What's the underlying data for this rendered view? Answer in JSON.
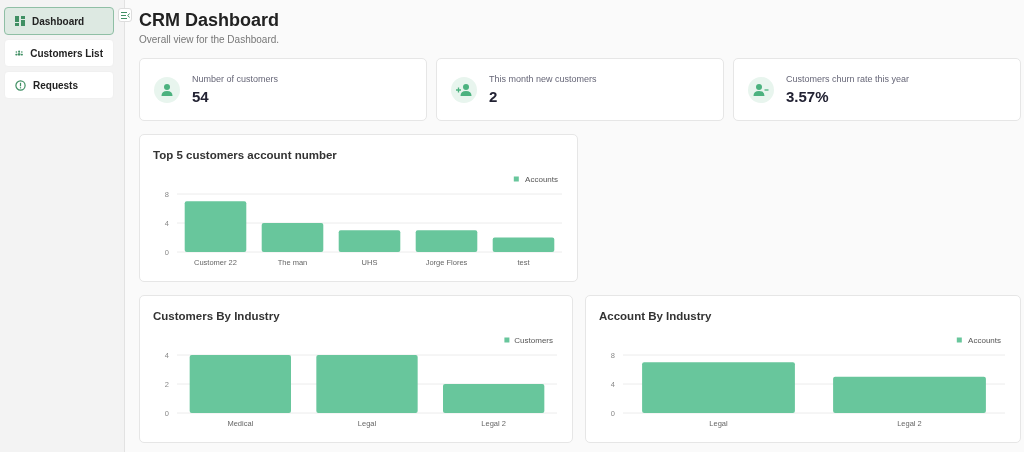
{
  "sidebar": {
    "items": [
      {
        "label": "Dashboard",
        "kind": "grid",
        "selected": true
      },
      {
        "label": "Customers List",
        "kind": "people",
        "selected": false
      },
      {
        "label": "Requests",
        "kind": "alert",
        "selected": false
      }
    ]
  },
  "header": {
    "title": "CRM Dashboard",
    "subtitle": "Overall view for the Dashboard."
  },
  "stats": [
    {
      "label": "Number of customers",
      "value": "54",
      "kind": "user"
    },
    {
      "label": "This month new customers",
      "value": "2",
      "kind": "user-plus"
    },
    {
      "label": "Customers churn rate this year",
      "value": "3.57%",
      "kind": "user-minus"
    }
  ],
  "charts": [
    {
      "title": "Top 5 customers account number",
      "chart_data": {
        "type": "bar",
        "categories": [
          "Customer 22",
          "The man",
          "UHS",
          "Jorge Flores",
          "test"
        ],
        "series": [
          {
            "name": "Accounts",
            "color": "#68c69c",
            "values": [
              7,
              4,
              3,
              3,
              2
            ]
          }
        ],
        "ylim": [
          0,
          8
        ],
        "yticks": [
          0,
          4,
          8
        ]
      }
    },
    {
      "title": "Customers By Industry",
      "chart_data": {
        "type": "bar",
        "categories": [
          "Medical",
          "Legal",
          "Legal 2"
        ],
        "series": [
          {
            "name": "Customers",
            "color": "#68c69c",
            "values": [
              4,
              4,
              2
            ]
          }
        ],
        "ylim": [
          0,
          4
        ],
        "yticks": [
          0,
          2,
          4
        ]
      }
    },
    {
      "title": "Account By Industry",
      "chart_data": {
        "type": "bar",
        "categories": [
          "Legal",
          "Legal 2"
        ],
        "series": [
          {
            "name": "Accounts",
            "color": "#68c69c",
            "values": [
              7,
              5
            ]
          }
        ],
        "ylim": [
          0,
          8
        ],
        "yticks": [
          0,
          4,
          8
        ]
      }
    }
  ]
}
